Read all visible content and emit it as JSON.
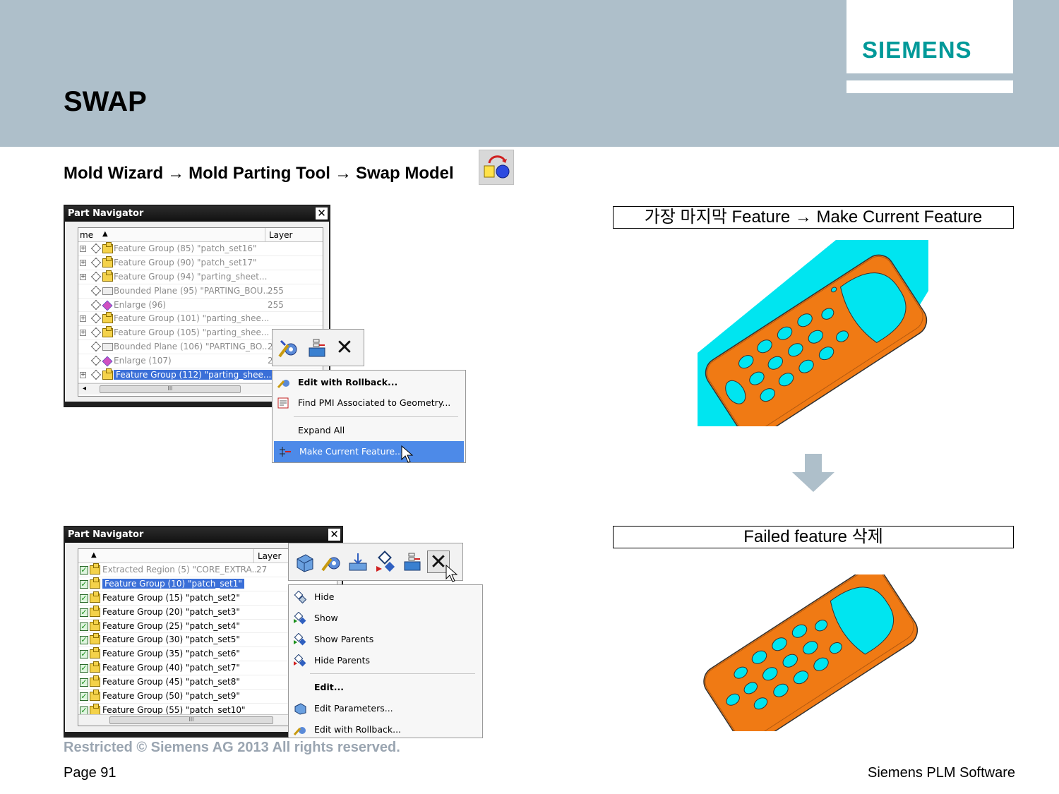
{
  "header": {
    "title": "SWAP",
    "logo": "SIEMENS"
  },
  "breadcrumb": {
    "step1": "Mold Wizard",
    "arrow": "→",
    "step2": "Mold Parting Tool",
    "step3": "Swap Model"
  },
  "captions": {
    "top": "가장 마지막 Feature → Make Current Feature",
    "bottom": "Failed feature 삭제"
  },
  "nav1": {
    "title": "Part Navigator",
    "close": "✕",
    "col_name": "me",
    "col_layer": "Layer",
    "rows": [
      {
        "text": "Feature Group (85) \"patch_set16\"",
        "layer": ""
      },
      {
        "text": "Feature Group (90) \"patch_set17\"",
        "layer": ""
      },
      {
        "text": "Feature Group (94) \"parting_sheet...",
        "layer": ""
      },
      {
        "text": "Bounded Plane (95) \"PARTING_BOU...",
        "layer": "255"
      },
      {
        "text": "Enlarge (96)",
        "layer": "255"
      },
      {
        "text": "Feature Group (101) \"parting_shee...",
        "layer": ""
      },
      {
        "text": "Feature Group (105) \"parting_shee...",
        "layer": ""
      },
      {
        "text": "Bounded Plane (106) \"PARTING_BO...",
        "layer": "2"
      },
      {
        "text": "Enlarge (107)",
        "layer": "2"
      },
      {
        "text": "Feature Group (112) \"parting_shee...",
        "layer": ""
      }
    ]
  },
  "menu1": {
    "items": [
      {
        "label": "Edit with Rollback..."
      },
      {
        "label": "Find PMI Associated to Geometry..."
      },
      {
        "label": "Expand All"
      },
      {
        "label": "Make Current Feature..."
      }
    ]
  },
  "nav2": {
    "title": "Part Navigator",
    "close": "✕",
    "col_name": "▲",
    "col_layer": "Layer",
    "rows": [
      {
        "text": "Extracted Region (5) \"CORE_EXTRA...",
        "layer": "27"
      },
      {
        "text": "Feature Group (10) \"patch_set1\"",
        "layer": ""
      },
      {
        "text": "Feature Group (15) \"patch_set2\"",
        "layer": ""
      },
      {
        "text": "Feature Group (20) \"patch_set3\"",
        "layer": ""
      },
      {
        "text": "Feature Group (25) \"patch_set4\"",
        "layer": ""
      },
      {
        "text": "Feature Group (30) \"patch_set5\"",
        "layer": ""
      },
      {
        "text": "Feature Group (35) \"patch_set6\"",
        "layer": ""
      },
      {
        "text": "Feature Group (40) \"patch_set7\"",
        "layer": ""
      },
      {
        "text": "Feature Group (45) \"patch_set8\"",
        "layer": ""
      },
      {
        "text": "Feature Group (50) \"patch_set9\"",
        "layer": ""
      },
      {
        "text": "Feature Group (55) \"patch_set10\"",
        "layer": ""
      }
    ]
  },
  "menu2": {
    "items": [
      {
        "label": "Hide"
      },
      {
        "label": "Show"
      },
      {
        "label": "Show Parents"
      },
      {
        "label": "Hide Parents"
      },
      {
        "label": "Edit..."
      },
      {
        "label": "Edit Parameters..."
      },
      {
        "label": "Edit with Rollback..."
      }
    ]
  },
  "footer": {
    "restricted": "Restricted © Siemens AG 2013 All rights reserved.",
    "page": "Page 91",
    "company": "Siemens PLM Software"
  },
  "colors": {
    "header_band": "#aebfca",
    "siemens_teal": "#009999",
    "model_orange": "#f07a14",
    "model_cyan": "#00e5f0",
    "highlight_blue": "#4d8ae8"
  }
}
